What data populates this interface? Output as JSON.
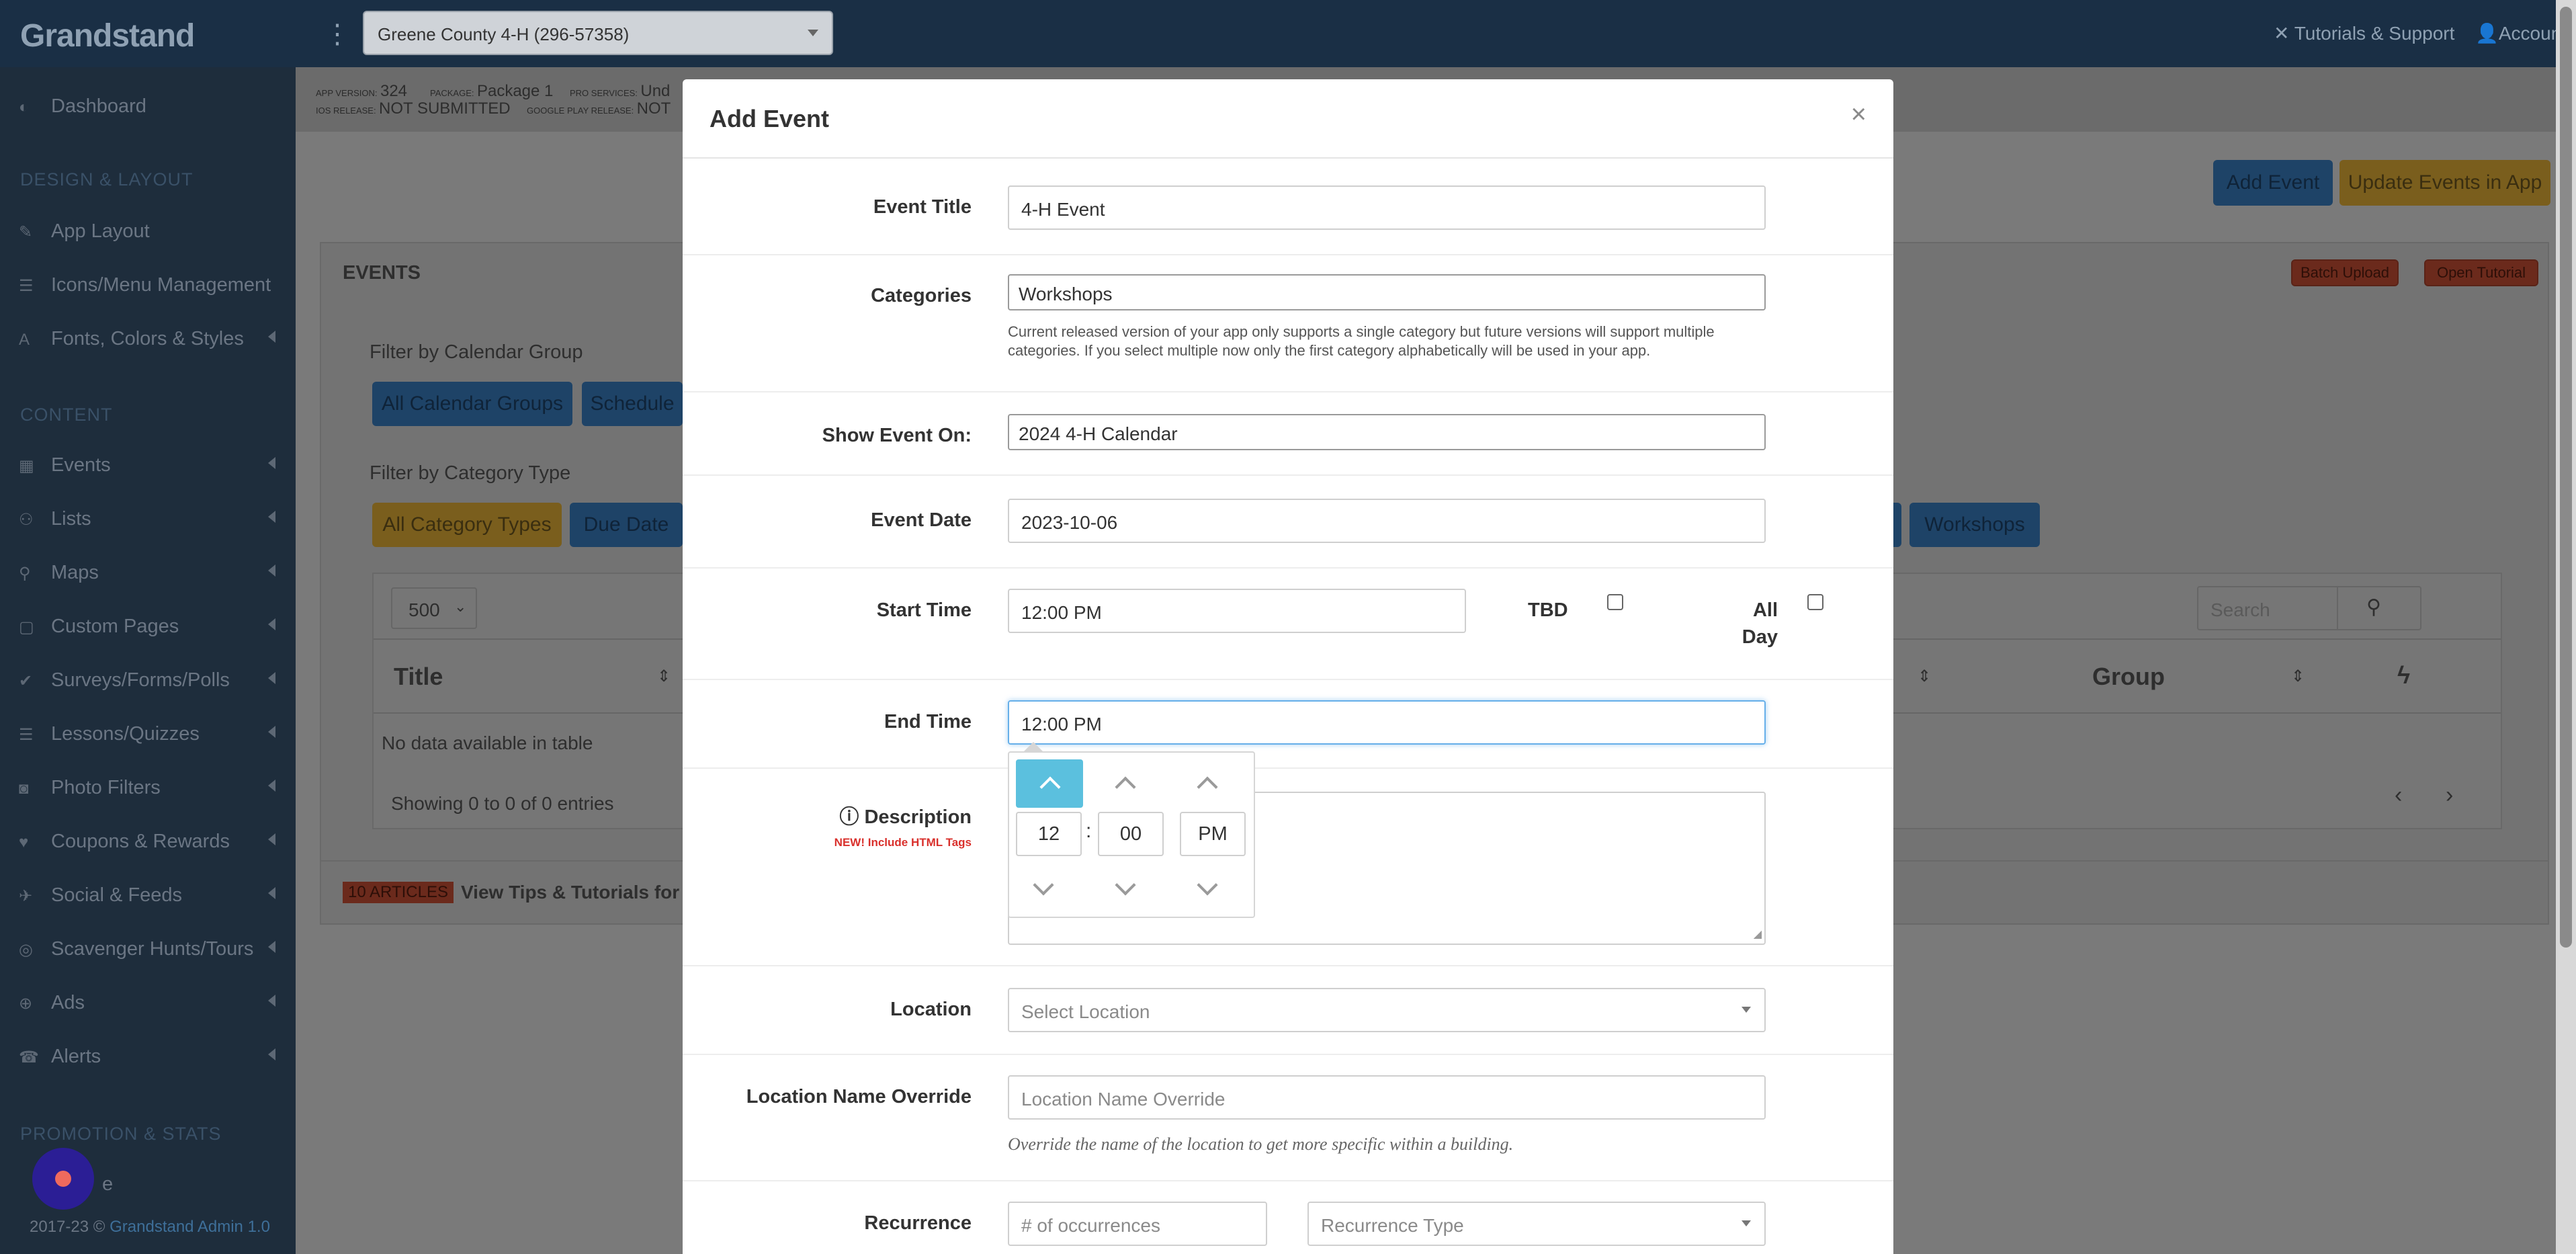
{
  "topbar": {
    "brand": "Grandstand",
    "app_selector": "Greene County 4-H (296-57358)",
    "tutorials": "Tutorials & Support",
    "account": "Accoun"
  },
  "sidebar": {
    "dashboard": "Dashboard",
    "design_heading": "DESIGN & LAYOUT",
    "app_layout": "App Layout",
    "icons_menu": "Icons/Menu Management",
    "fonts_colors": "Fonts, Colors & Styles",
    "content_heading": "CONTENT",
    "events": "Events",
    "lists": "Lists",
    "maps": "Maps",
    "custom_pages": "Custom Pages",
    "surveys": "Surveys/Forms/Polls",
    "lessons": "Lessons/Quizzes",
    "photo_filters": "Photo Filters",
    "coupons": "Coupons & Rewards",
    "social": "Social & Feeds",
    "scavenger": "Scavenger Hunts/Tours",
    "ads": "Ads",
    "alerts": "Alerts",
    "promo_heading": "PROMOTION & STATS",
    "partial_item": "e",
    "footer_prefix": "2017-23 © ",
    "footer_link": "Grandstand Admin 1.0"
  },
  "infobar": {
    "app_version_label": "APP VERSION:",
    "app_version": "324",
    "package_label": "PACKAGE:",
    "package": "Package 1",
    "pro_services_label": "PRO SERVICES:",
    "pro_services": "Und",
    "ios_label": "IOS RELEASE:",
    "ios": "NOT SUBMITTED",
    "google_label": "GOOGLE PLAY RELEASE:",
    "google": "NOT"
  },
  "page": {
    "add_event": "Add Event",
    "update_events": "Update Events in App",
    "events_heading": "EVENTS",
    "batch_upload": "Batch Upload",
    "open_tutorial": "Open Tutorial",
    "filter_group_label": "Filter by Calendar Group",
    "all_calendar_groups": "All Calendar Groups",
    "schedule": "Schedule",
    "filter_category_label": "Filter by Category Type",
    "all_category_types": "All Category Types",
    "due_date": "Due Date",
    "workshops_filter": "Workshops",
    "page_size": "500",
    "search_placeholder": "Search",
    "col_title": "Title",
    "col_group": "Group",
    "no_data": "No data available in table",
    "showing": "Showing 0 to 0 of 0 entries",
    "articles_badge": "10 ARTICLES",
    "tips_link": "View Tips & Tutorials for E"
  },
  "modal": {
    "title": "Add Event",
    "close": "×",
    "event_title_label": "Event Title",
    "event_title_value": "4-H Event",
    "categories_label": "Categories",
    "categories_value": "Workshops",
    "categories_help": "Current released version of your app only supports a single category but future versions will support multiple categories. If you select multiple now only the first category alphabetically will be used in your app.",
    "show_on_label": "Show Event On:",
    "show_on_value": "2024 4-H Calendar",
    "event_date_label": "Event Date",
    "event_date_value": "2023-10-06",
    "start_time_label": "Start Time",
    "start_time_value": "12:00 PM",
    "tbd_label": "TBD",
    "all_day_label": "All Day",
    "end_time_label": "End Time",
    "end_time_value": "12:00 PM",
    "description_label": "Description",
    "description_note": "NEW! Include HTML Tags",
    "location_label": "Location",
    "location_placeholder": "Select Location",
    "location_override_label": "Location Name Override",
    "location_override_placeholder": "Location Name Override",
    "location_override_help": "Override the name of the location to get more specific within a building.",
    "recurrence_label": "Recurrence",
    "occurrences_placeholder": "# of occurrences",
    "recurrence_type_placeholder": "Recurrence Type"
  },
  "time_picker": {
    "hour": "12",
    "separator": ":",
    "minute": "00",
    "meridian": "PM"
  },
  "colors": {
    "accent_blue": "#3276b1",
    "picker_highlight": "#5bc0de",
    "warning_gold": "#f0ad4e",
    "danger_red": "#d9534f"
  }
}
